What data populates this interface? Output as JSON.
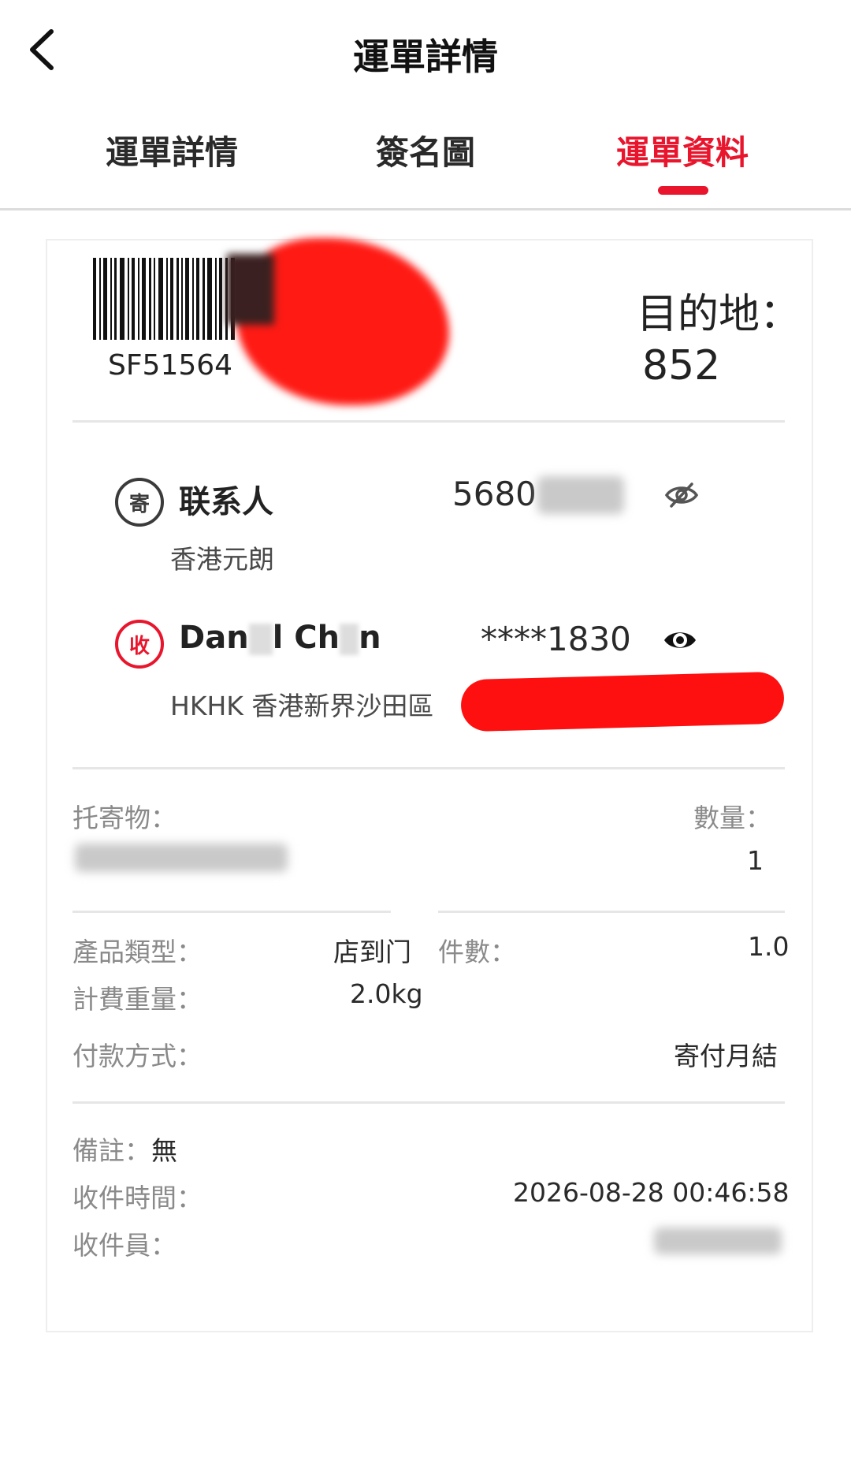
{
  "header": {
    "title": "運單詳情",
    "back_icon": "chevron-left-icon"
  },
  "tabs": [
    {
      "label": "運單詳情",
      "active": false
    },
    {
      "label": "簽名圖",
      "active": false
    },
    {
      "label": "運單資料",
      "active": true
    }
  ],
  "colors": {
    "accent": "#e8152d",
    "text": "#222222",
    "label": "#8a8a8a",
    "divider": "#e6e6e6"
  },
  "waybill": {
    "number_visible": "SF51564",
    "destination_label": "目的地：",
    "destination_code": "852"
  },
  "sender": {
    "badge": "寄",
    "name": "联系人",
    "phone_visible": "5680",
    "address": "香港元朗",
    "eye_icon": "eye-off-icon"
  },
  "receiver": {
    "badge": "收",
    "name_part1": "Dan",
    "name_part2": "l Ch",
    "name_part3": "n",
    "phone": "****1830",
    "address_visible": "HKHK 香港新界沙田區",
    "eye_icon": "eye-icon"
  },
  "consignment": {
    "item_label": "托寄物：",
    "quantity_label": "數量：",
    "quantity_value": "1"
  },
  "details": {
    "product_type_label": "產品類型：",
    "product_type_value": "店到门",
    "pieces_label": "件數：",
    "pieces_value": "1.0",
    "weight_label": "計費重量：",
    "weight_value": "2.0kg",
    "payment_label": "付款方式：",
    "payment_value": "寄付月結"
  },
  "footer": {
    "remark_label": "備註：",
    "remark_value": "無",
    "pickup_time_label": "收件時間：",
    "pickup_time_value": "2026-08-28 00:46:58",
    "courier_label": "收件員："
  }
}
